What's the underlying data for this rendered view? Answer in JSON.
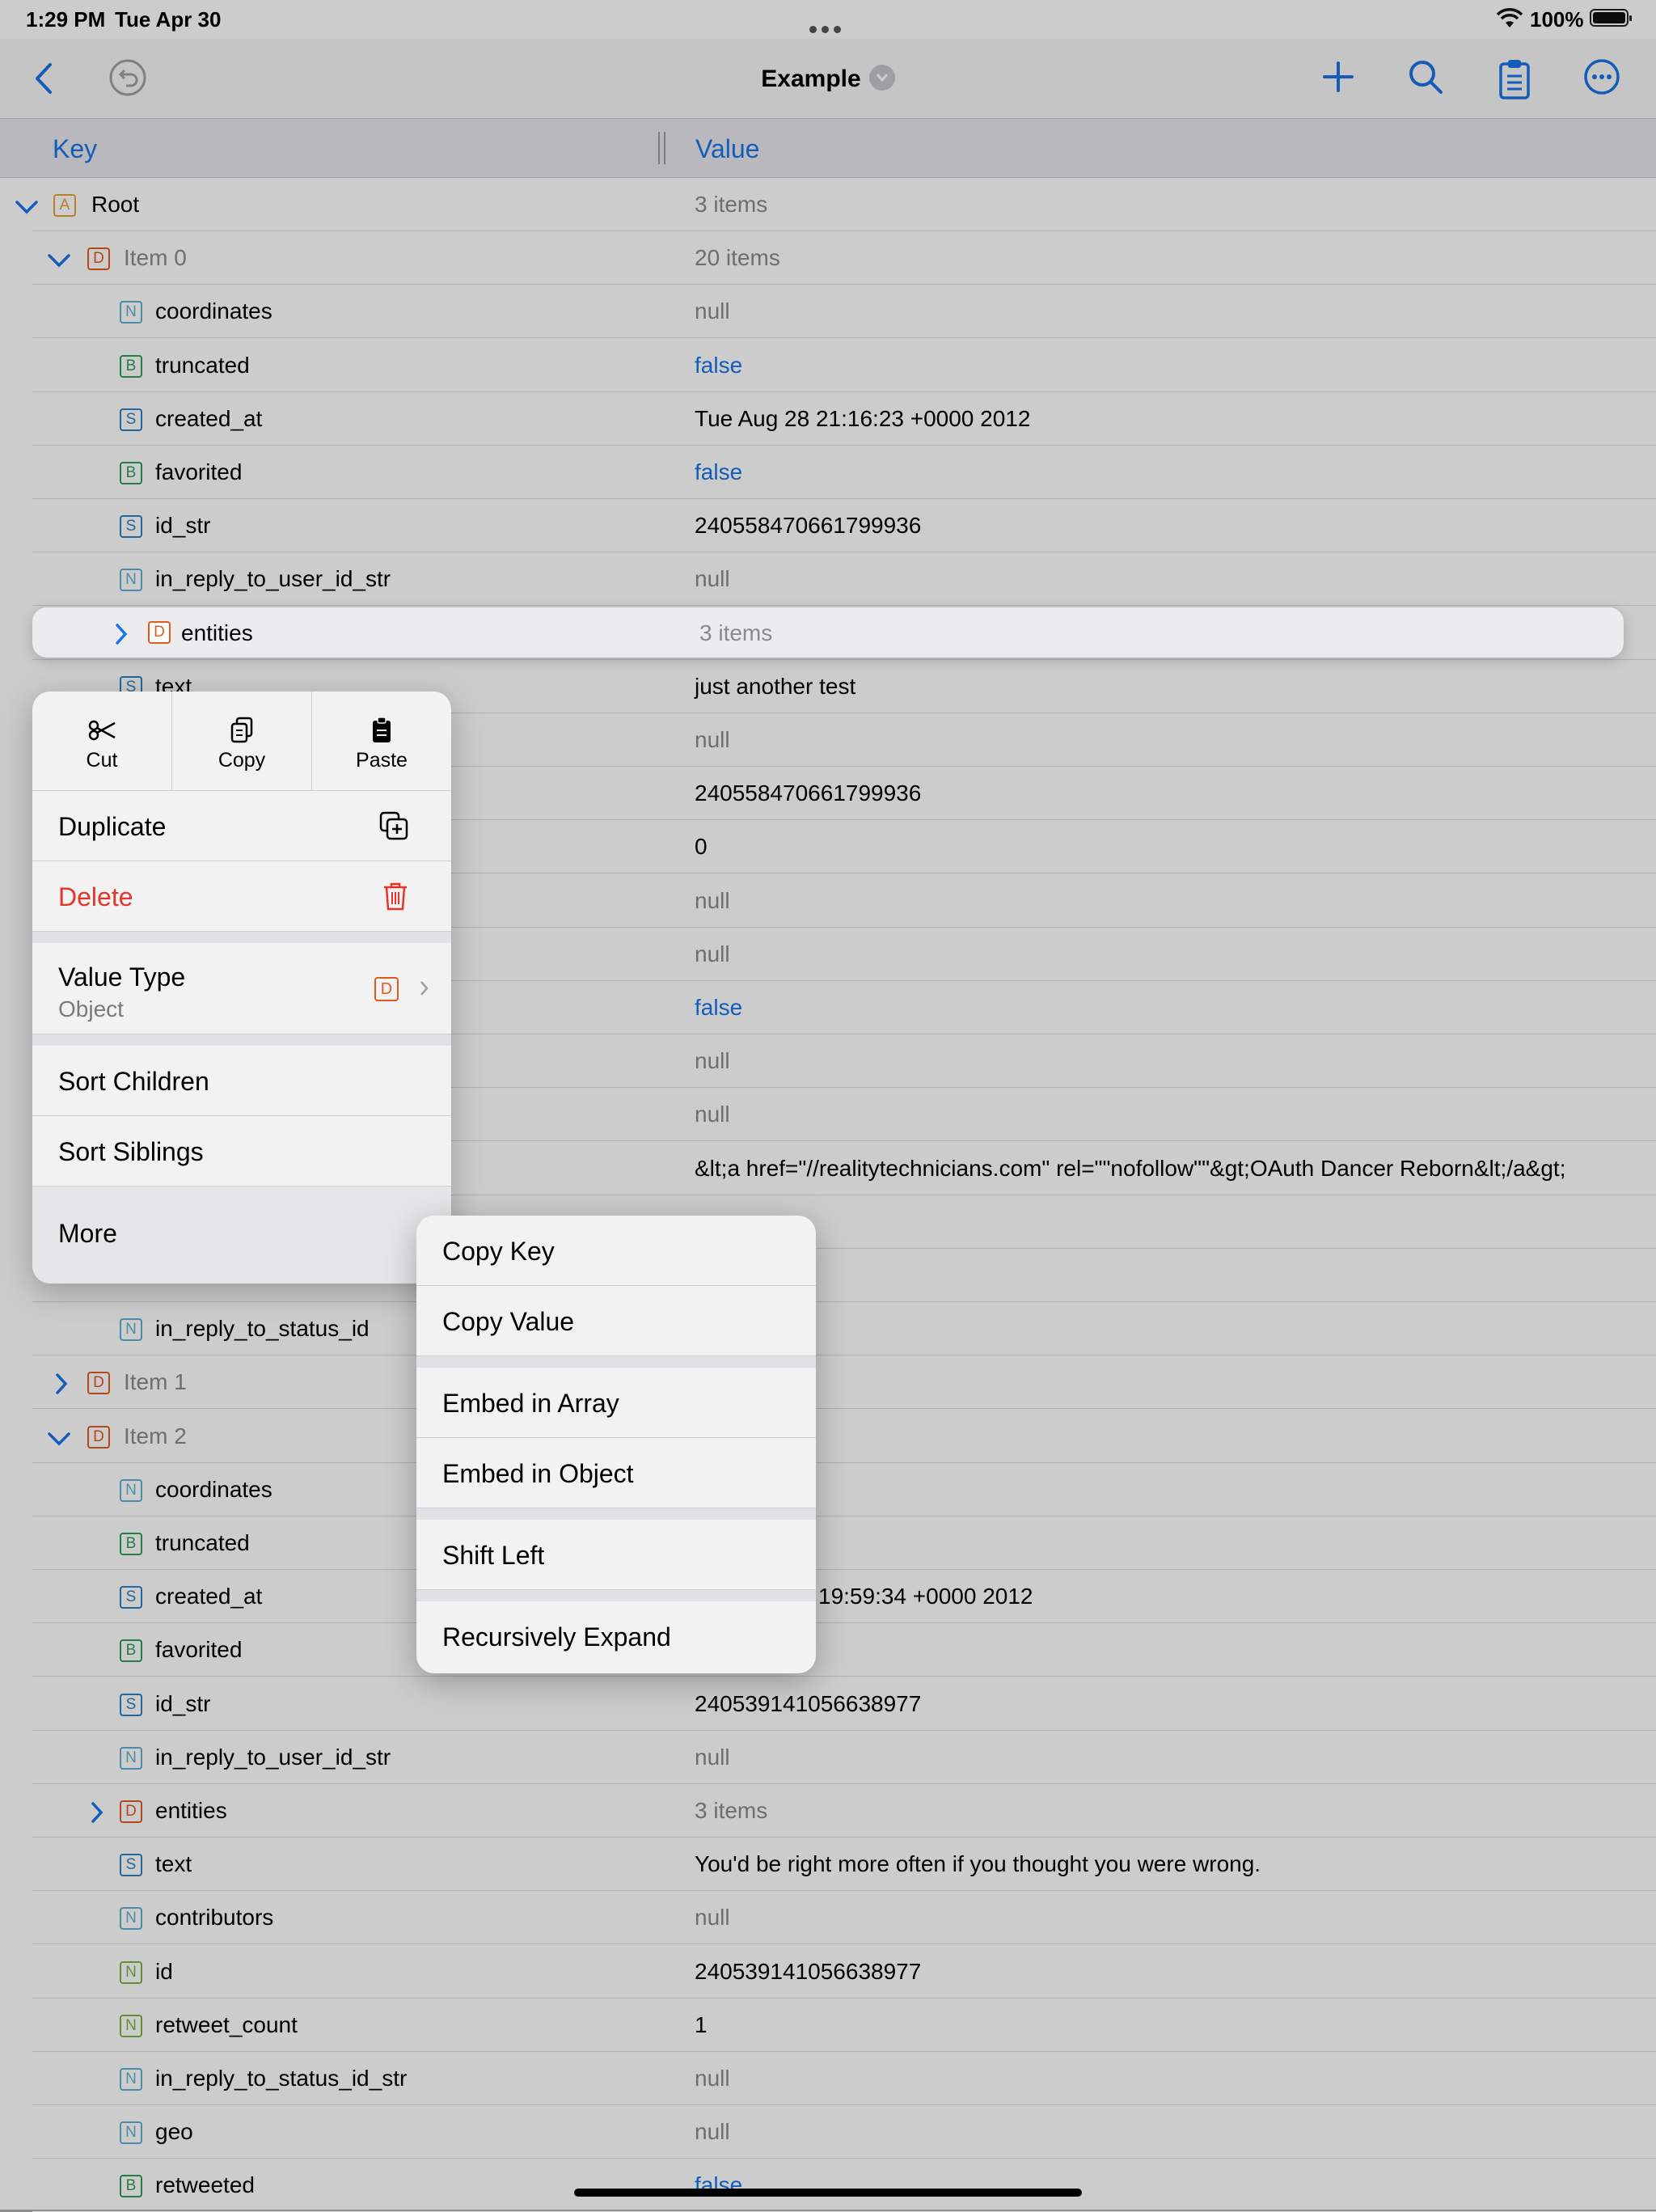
{
  "status": {
    "time": "1:29 PM",
    "date": "Tue Apr 30",
    "battery": "100%"
  },
  "navbar": {
    "title": "Example"
  },
  "columns": {
    "key": "Key",
    "value": "Value"
  },
  "rows": [
    {
      "key": "Root",
      "value": "3 items",
      "type": "A",
      "expander": "down",
      "level": 0,
      "key_style": "",
      "value_style": "grey"
    },
    {
      "key": "Item 0",
      "value": "20 items",
      "type": "D",
      "expander": "down",
      "level": 1,
      "key_style": "grey",
      "value_style": "grey"
    },
    {
      "key": "coordinates",
      "value": "null",
      "type": "N",
      "level": 2,
      "value_style": "grey"
    },
    {
      "key": "truncated",
      "value": "false",
      "type": "B",
      "level": 2,
      "value_style": "blue"
    },
    {
      "key": "created_at",
      "value": "Tue Aug 28 21:16:23 +0000 2012",
      "type": "S",
      "level": 2,
      "value_style": ""
    },
    {
      "key": "favorited",
      "value": "false",
      "type": "B",
      "level": 2,
      "value_style": "blue"
    },
    {
      "key": "id_str",
      "value": "240558470661799936",
      "type": "S",
      "level": 2,
      "value_style": ""
    },
    {
      "key": "in_reply_to_user_id_str",
      "value": "null",
      "type": "N",
      "level": 2,
      "value_style": "grey"
    },
    {
      "key": "",
      "value": "",
      "type": "",
      "level": 2,
      "value_style": ""
    },
    {
      "key": "text",
      "value": "just another test",
      "type": "S",
      "level": 2,
      "value_style": ""
    },
    {
      "key": "",
      "value": "null",
      "type": "",
      "level": 2,
      "value_style": "grey"
    },
    {
      "key": "",
      "value": "240558470661799936",
      "type": "",
      "level": 2,
      "value_style": ""
    },
    {
      "key": "",
      "value": "0",
      "type": "",
      "level": 2,
      "value_style": ""
    },
    {
      "key": "",
      "value": "null",
      "type": "",
      "level": 2,
      "value_style": "grey"
    },
    {
      "key": "",
      "value": "null",
      "type": "",
      "level": 2,
      "value_style": "grey"
    },
    {
      "key": "",
      "value": "false",
      "type": "",
      "level": 2,
      "value_style": "blue"
    },
    {
      "key": "",
      "value": "null",
      "type": "",
      "level": 2,
      "value_style": "grey"
    },
    {
      "key": "",
      "value": "null",
      "type": "",
      "level": 2,
      "value_style": "grey"
    },
    {
      "key": "",
      "value": "&lt;a href=\"//realitytechnicians.com\" rel=\"\"nofollow\"\"&gt;OAuth Dancer Reborn&lt;/a&gt;",
      "type": "",
      "level": 2,
      "value_style": ""
    },
    {
      "key": "",
      "value": "",
      "type": "",
      "level": 2,
      "value_style": "grey"
    },
    {
      "key": "",
      "value": "",
      "type": "",
      "level": 2,
      "value_style": ""
    },
    {
      "key": "in_reply_to_status_id",
      "value": "",
      "type": "N",
      "level": 2,
      "value_style": "grey"
    },
    {
      "key": "Item 1",
      "value": "",
      "type": "D",
      "expander": "right",
      "level": 1,
      "key_style": "grey",
      "value_style": "grey"
    },
    {
      "key": "Item 2",
      "value": "",
      "type": "D",
      "expander": "down",
      "level": 1,
      "key_style": "grey",
      "value_style": "grey"
    },
    {
      "key": "coordinates",
      "value": "",
      "type": "N",
      "level": 2,
      "value_style": "grey"
    },
    {
      "key": "truncated",
      "value": "",
      "type": "B",
      "level": 2,
      "value_style": "blue"
    },
    {
      "key": "created_at",
      "value": "19:59:34 +0000 2012",
      "type": "S",
      "level": 2,
      "value_style": "",
      "value_offset": true
    },
    {
      "key": "favorited",
      "value": "",
      "type": "B",
      "level": 2,
      "value_style": "blue"
    },
    {
      "key": "id_str",
      "value": "240539141056638977",
      "type": "S",
      "level": 2,
      "value_style": ""
    },
    {
      "key": "in_reply_to_user_id_str",
      "value": "null",
      "type": "N",
      "level": 2,
      "value_style": "grey"
    },
    {
      "key": "entities",
      "value": "3 items",
      "type": "D",
      "expander": "right",
      "level": 2,
      "value_style": "grey"
    },
    {
      "key": "text",
      "value": "You'd be right more often if you thought you were wrong.",
      "type": "S",
      "level": 2,
      "value_style": ""
    },
    {
      "key": "contributors",
      "value": "null",
      "type": "N",
      "level": 2,
      "value_style": "grey"
    },
    {
      "key": "id",
      "value": "240539141056638977",
      "type": "Ng",
      "level": 2,
      "value_style": ""
    },
    {
      "key": "retweet_count",
      "value": "1",
      "type": "Ng",
      "level": 2,
      "value_style": ""
    },
    {
      "key": "in_reply_to_status_id_str",
      "value": "null",
      "type": "N",
      "level": 2,
      "value_style": "grey"
    },
    {
      "key": "geo",
      "value": "null",
      "type": "N",
      "level": 2,
      "value_style": "grey"
    },
    {
      "key": "retweeted",
      "value": "false",
      "type": "B",
      "level": 2,
      "value_style": "blue"
    }
  ],
  "highlighted_row": {
    "key": "entities",
    "value": "3 items",
    "type": "D"
  },
  "context_menu": {
    "cut": "Cut",
    "copy": "Copy",
    "paste": "Paste",
    "duplicate": "Duplicate",
    "delete": "Delete",
    "value_type": "Value Type",
    "value_type_sub": "Object",
    "value_type_badge": "D",
    "sort_children": "Sort Children",
    "sort_siblings": "Sort Siblings",
    "more": "More"
  },
  "submenu": {
    "copy_key": "Copy Key",
    "copy_value": "Copy Value",
    "embed_array": "Embed in Array",
    "embed_object": "Embed in Object",
    "shift_left": "Shift Left",
    "recursively_expand": "Recursively Expand"
  },
  "colors": {
    "accent": "#1a73e8",
    "destructive": "#e5352b"
  }
}
